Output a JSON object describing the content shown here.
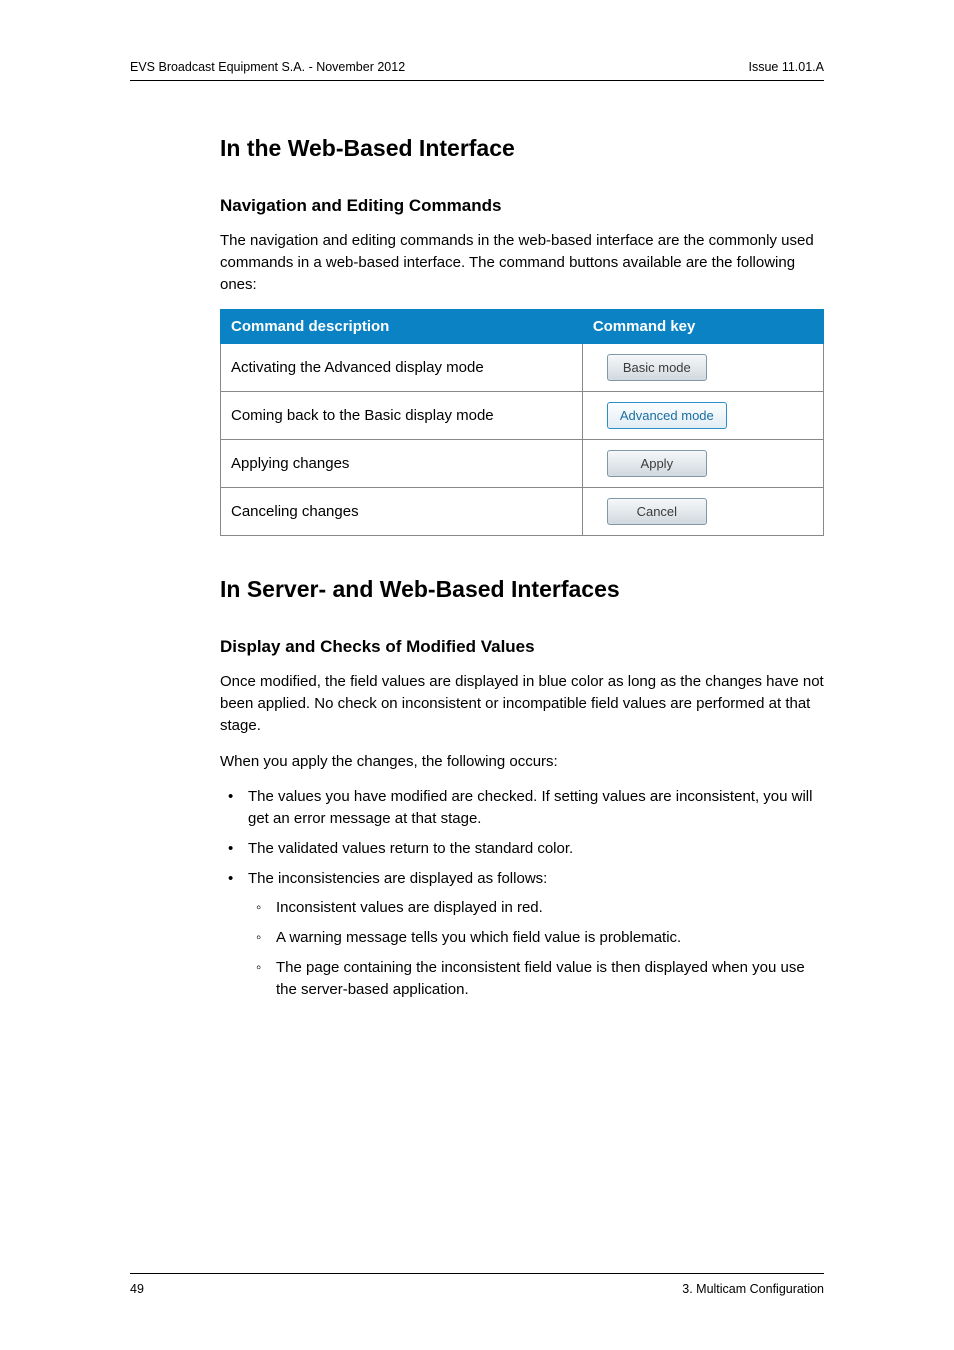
{
  "header": {
    "left": "EVS Broadcast Equipment S.A.  - November 2012",
    "right": "Issue 11.01.A"
  },
  "section1": {
    "heading": "In the Web-Based Interface",
    "sub1": {
      "heading": "Navigation and Editing Commands",
      "intro": "The navigation and editing commands in the web-based interface are the commonly used commands in a web-based interface. The command buttons available are the following ones:",
      "table": {
        "col1": "Command description",
        "col2": "Command key",
        "rows": [
          {
            "desc": "Activating the Advanced display mode",
            "btn": "Basic mode",
            "active": false
          },
          {
            "desc": "Coming back to the Basic display mode",
            "btn": "Advanced mode",
            "active": true
          },
          {
            "desc": "Applying changes",
            "btn": "Apply",
            "active": false
          },
          {
            "desc": "Canceling changes",
            "btn": "Cancel",
            "active": false
          }
        ]
      }
    }
  },
  "section2": {
    "heading": "In Server- and Web-Based Interfaces",
    "sub1": {
      "heading": "Display and Checks of Modified Values",
      "para1": "Once modified, the field values are displayed in blue color as long as the changes have not been applied. No check on inconsistent or incompatible field values are performed at that stage.",
      "para2": "When you apply the changes, the following occurs:",
      "bullets": [
        "The values you have modified are checked. If setting values are inconsistent, you will get an error message at that stage.",
        "The validated values return to the standard color.",
        "The inconsistencies are displayed as follows:"
      ],
      "subbullets": [
        "Inconsistent values are displayed in red.",
        "A warning message tells you which field value is problematic.",
        "The page containing the inconsistent field value is then displayed when you use the server-based application."
      ]
    }
  },
  "footer": {
    "left": "49",
    "right": "3. Multicam Configuration"
  }
}
